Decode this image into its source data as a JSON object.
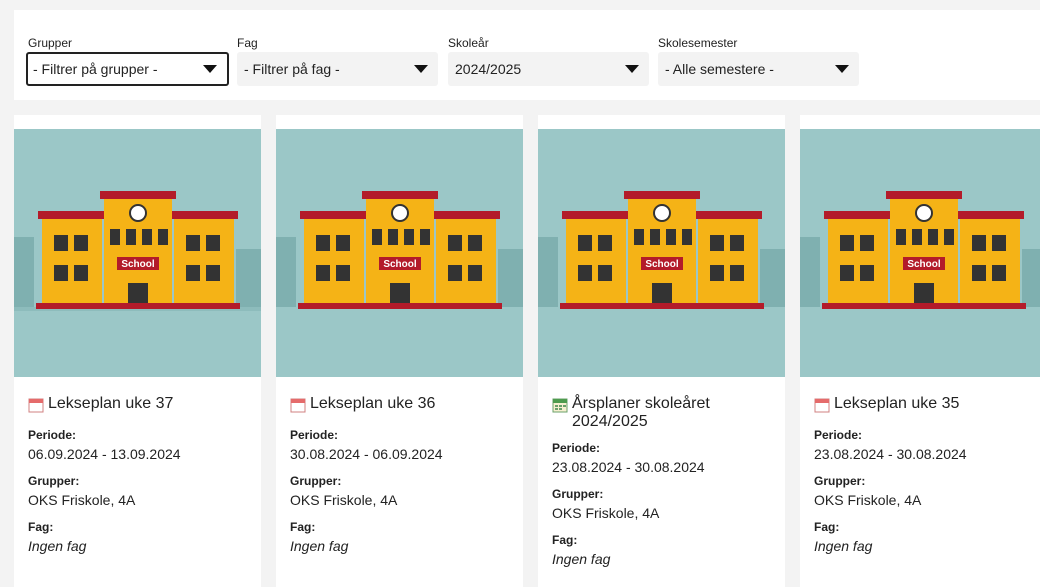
{
  "filters": [
    {
      "label": "Grupper",
      "value": "- Filtrer på grupper -"
    },
    {
      "label": "Fag",
      "value": "- Filtrer på fag -"
    },
    {
      "label": "Skoleår",
      "value": "2024/2025"
    },
    {
      "label": "Skolesemester",
      "value": "- Alle semestere -"
    }
  ],
  "image_text": "School",
  "labels": {
    "periode": "Periode:",
    "grupper": "Grupper:",
    "fag": "Fag:"
  },
  "cards": [
    {
      "title": "Lekseplan uke 37",
      "icon": "calendar-icon",
      "periode": "06.09.2024 - 13.09.2024",
      "grupper": "OKS Friskole, 4A",
      "fag": "Ingen fag"
    },
    {
      "title": "Lekseplan uke 36",
      "icon": "calendar-icon",
      "periode": "30.08.2024 - 06.09.2024",
      "grupper": "OKS Friskole, 4A",
      "fag": "Ingen fag"
    },
    {
      "title": "Årsplaner skoleåret 2024/2025",
      "icon": "calendar-grid-icon",
      "periode": "23.08.2024 - 30.08.2024",
      "grupper": "OKS Friskole, 4A",
      "fag": "Ingen fag"
    },
    {
      "title": "Lekseplan uke 35",
      "icon": "calendar-icon",
      "periode": "23.08.2024 - 30.08.2024",
      "grupper": "OKS Friskole, 4A",
      "fag": "Ingen fag"
    }
  ],
  "colors": {
    "page_bg": "#f3f3f3",
    "image_bg": "#9bc7c7",
    "building_yellow": "#f5b316",
    "building_red": "#b31b2a"
  }
}
